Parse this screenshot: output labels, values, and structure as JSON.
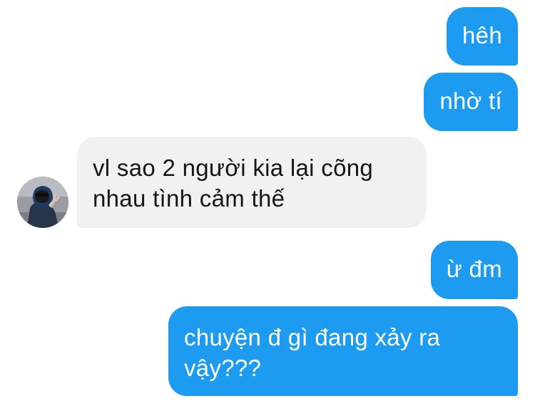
{
  "messages": [
    {
      "sender": "me",
      "text": "hêh"
    },
    {
      "sender": "me",
      "text": "nhờ tí"
    },
    {
      "sender": "other",
      "text": "vl sao 2 người kia lại cõng nhau tình cảm thế"
    },
    {
      "sender": "me",
      "text": "ừ đm"
    },
    {
      "sender": "me",
      "text": "chuyện đ gì đang xảy ra vậy???"
    }
  ],
  "colors": {
    "sent_bubble": "#1d9bf0",
    "received_bubble": "#eff1f3",
    "sent_text": "#ffffff",
    "received_text": "#14171a"
  },
  "icons": {
    "avatar": "user-avatar"
  }
}
